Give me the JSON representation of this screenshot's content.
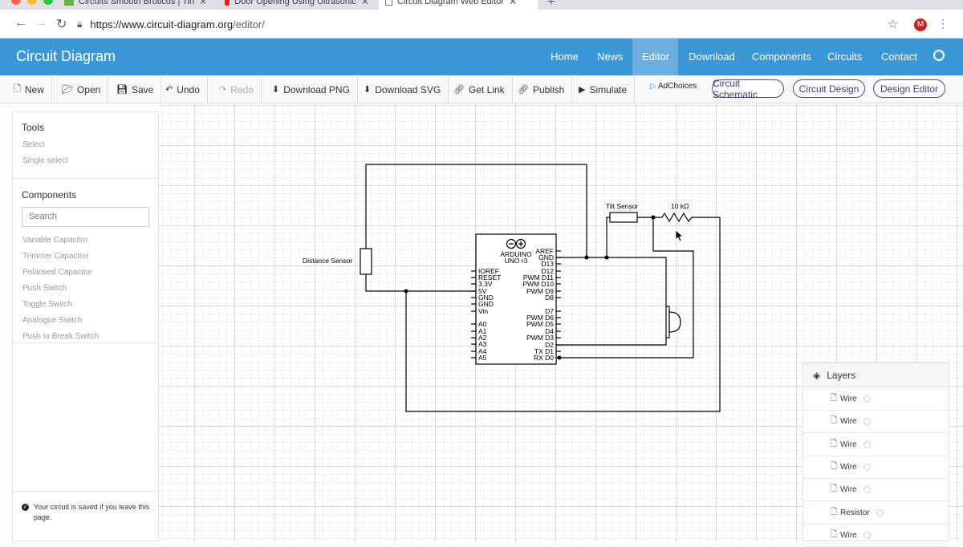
{
  "browser": {
    "tabs": [
      {
        "title": "Circuits Smooth Bruticus | Tin"
      },
      {
        "title": "Door Opening Using Ultrasonic"
      },
      {
        "title": "Circuit Diagram Web Editor"
      }
    ],
    "url_host": "https://www.circuit-diagram.org",
    "url_path": "/editor/",
    "profile_initial": "M"
  },
  "app": {
    "brand": "Circuit Diagram",
    "nav": [
      "Home",
      "News",
      "Editor",
      "Download",
      "Components",
      "Circuits",
      "Contact"
    ],
    "active_nav": "Editor"
  },
  "toolbar": {
    "new": "New",
    "open": "Open",
    "save": "Save",
    "undo": "Undo",
    "redo": "Redo",
    "download_png": "Download PNG",
    "download_svg": "Download SVG",
    "get_link": "Get Link",
    "publish": "Publish",
    "simulate": "Simulate",
    "adchoices": "AdChoices",
    "pills": [
      "Circuit Schematic",
      "Circuit Design",
      "Design Editor"
    ]
  },
  "tools_panel": {
    "tools_title": "Tools",
    "tools": [
      "Select",
      "Single select"
    ],
    "components_title": "Components",
    "search_placeholder": "Search",
    "components": [
      "Variable Capacitor",
      "Trimmer Capacitor",
      "Polarised Capacitor",
      "Push Switch",
      "Toggle Switch",
      "Analogue Switch",
      "Push to Break Switch"
    ],
    "saved_message": "Your circuit is saved if you leave this page."
  },
  "layers_panel": {
    "title": "Layers",
    "items": [
      "Wire",
      "Wire",
      "Wire",
      "Wire",
      "Wire",
      "Resistor",
      "Wire"
    ]
  },
  "schematic": {
    "distance_sensor": "Distance Sensor",
    "tilt_sensor": "Tilt Sensor",
    "resistor_value": "10 kΩ",
    "board_line1": "ARDUINO",
    "board_line2": "UNO r3",
    "left_pins": [
      "IOREF",
      "RESET",
      "3.3V",
      "5V",
      "GND",
      "GND",
      "Vin",
      "A0",
      "A1",
      "A2",
      "A3",
      "A4",
      "A5"
    ],
    "right_pins": [
      "AREF",
      "GND",
      "D13",
      "D12",
      "PWM D11",
      "PWM D10",
      "PWM D9",
      "D8",
      "D7",
      "PWM D6",
      "PWM D5",
      "D4",
      "PWM D3",
      "D2",
      "TX D1",
      "RX D0"
    ]
  }
}
